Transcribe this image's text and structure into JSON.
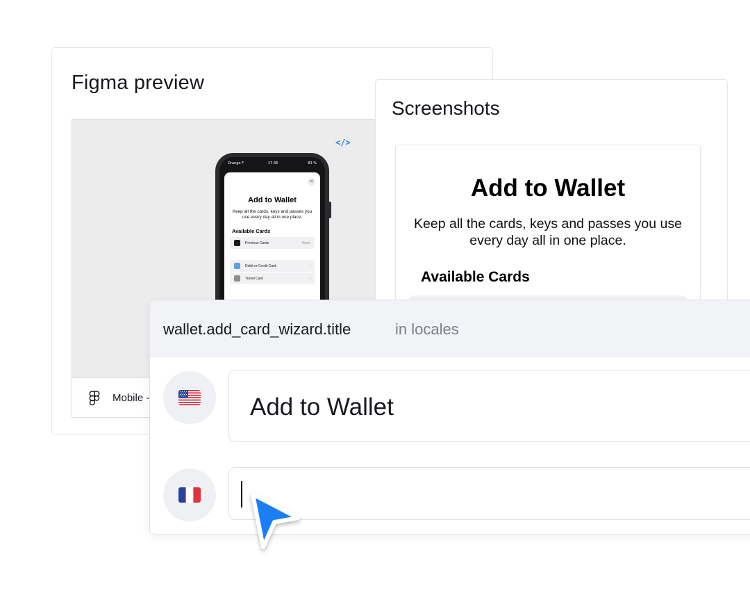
{
  "figma_preview": {
    "title": "Figma preview",
    "embed_icon": "</>",
    "file_name": "Mobile -",
    "phone": {
      "carrier": "Orange F",
      "time": "17:36",
      "battery": "83 %",
      "sheet_title": "Add to Wallet",
      "sheet_description": "Keep all the cards, keys and passes you use every day all in one place.",
      "section_title": "Available Cards",
      "rows": [
        {
          "label": "Previous Cards",
          "value": "None"
        },
        {
          "label": "Debit or Credit Card",
          "value": "›"
        },
        {
          "label": "Travel Card",
          "value": "›"
        }
      ]
    }
  },
  "screenshots": {
    "title": "Screenshots",
    "shot_title": "Add to Wallet",
    "shot_description": "Keep all the cards, keys and passes you use every day all in one place.",
    "shot_section": "Available Cards"
  },
  "translation": {
    "key": "wallet.add_card_wizard.title",
    "context": "in locales",
    "locales": [
      {
        "flag": "us-flag-icon",
        "value": "Add to Wallet"
      },
      {
        "flag": "fr-flag-icon",
        "value": ""
      }
    ]
  },
  "colors": {
    "accent_blue": "#1a7ef5",
    "header_bg": "#f1f3f7",
    "border": "#e3e5e8"
  }
}
